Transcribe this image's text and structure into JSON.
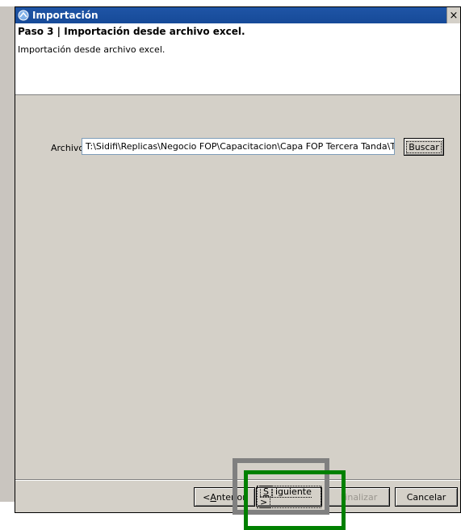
{
  "window": {
    "title": "Importación",
    "close_glyph": "×"
  },
  "header": {
    "step_title": "Paso 3 | Importación desde archivo excel.",
    "step_description": "Importación desde archivo excel."
  },
  "form": {
    "archivo_label": "Archivo",
    "archivo_value": "T:\\Sidifi\\Replicas\\Negocio FOP\\Capacitacion\\Capa FOP Tercera Tanda\\Temp",
    "buscar_label": "Buscar"
  },
  "footer": {
    "anterior_pre": "< ",
    "anterior_u": "A",
    "anterior_post": "nterior",
    "siguiente_u": "S",
    "siguiente_post": "iguiente >",
    "finalizar_label": "Finalizar",
    "cancelar_label": "Cancelar"
  },
  "colors": {
    "titlebar": "#1f55a6",
    "dialog_bg": "#d4d0c8",
    "highlight_gray": "#808080",
    "highlight_green": "#008000"
  },
  "icons": {
    "app": "globe-arrow-icon",
    "close": "close-icon"
  }
}
